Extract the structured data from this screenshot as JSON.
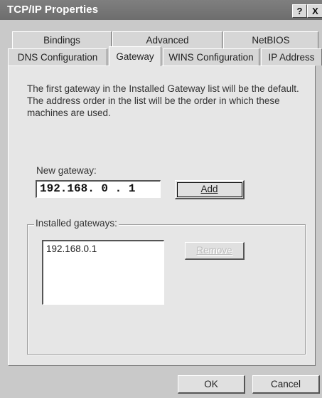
{
  "window": {
    "title": "TCP/IP Properties",
    "help_glyph": "?",
    "close_glyph": "X"
  },
  "tabs": {
    "row1": [
      "Bindings",
      "Advanced",
      "NetBIOS"
    ],
    "row2": [
      "DNS Configuration",
      "Gateway",
      "WINS Configuration",
      "IP Address"
    ],
    "active": "Gateway"
  },
  "gateway": {
    "description": "The first gateway in the Installed Gateway list will be the default.\nThe address order in the list will be the order in which these\nmachines are used.",
    "new_gateway_label": "New gateway:",
    "new_gateway_value": "192.168. 0 . 1",
    "add_label": "Add",
    "installed_label": "Installed gateways:",
    "installed": [
      "192.168.0.1"
    ],
    "remove_label": "Remove"
  },
  "footer": {
    "ok_label": "OK",
    "cancel_label": "Cancel"
  }
}
